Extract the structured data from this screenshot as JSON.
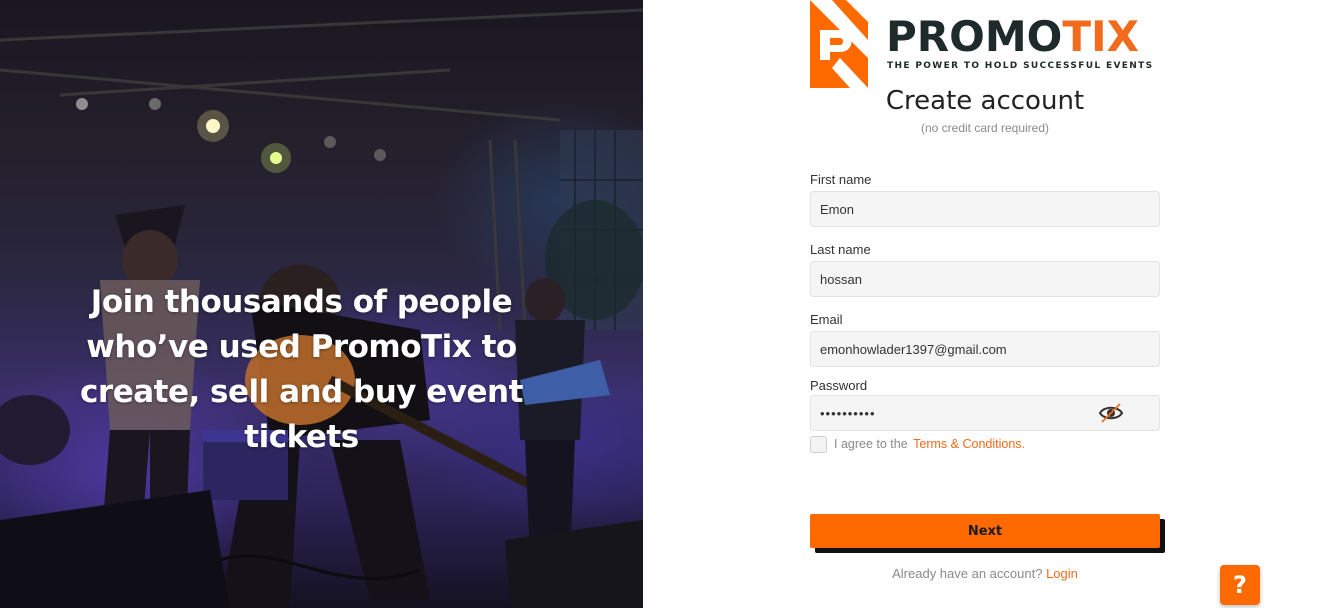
{
  "hero": {
    "headline": "Join thousands of people who’ve used PromoTix to create, sell and buy event tickets"
  },
  "brand": {
    "name_dark": "PROMO",
    "name_accent": "TIX",
    "tagline": "THE POWER TO HOLD SUCCESSFUL EVENTS",
    "accent_color": "#ff6a00"
  },
  "form": {
    "title": "Create account",
    "subtitle": "(no credit card required)",
    "first_name": {
      "label": "First name",
      "value": "Emon"
    },
    "last_name": {
      "label": "Last name",
      "value": "hossan"
    },
    "email": {
      "label": "Email",
      "value": "emonhowlader1397@gmail.com"
    },
    "password": {
      "label": "Password",
      "value": "••••••••••",
      "toggle_icon": "eye-slash-icon"
    },
    "terms": {
      "checked": false,
      "text": "I agree to the",
      "link": "Terms & Conditions."
    },
    "submit_label": "Next",
    "login_prompt": "Already have an account?",
    "login_link": "Login"
  },
  "help_button": {
    "label": "?"
  }
}
